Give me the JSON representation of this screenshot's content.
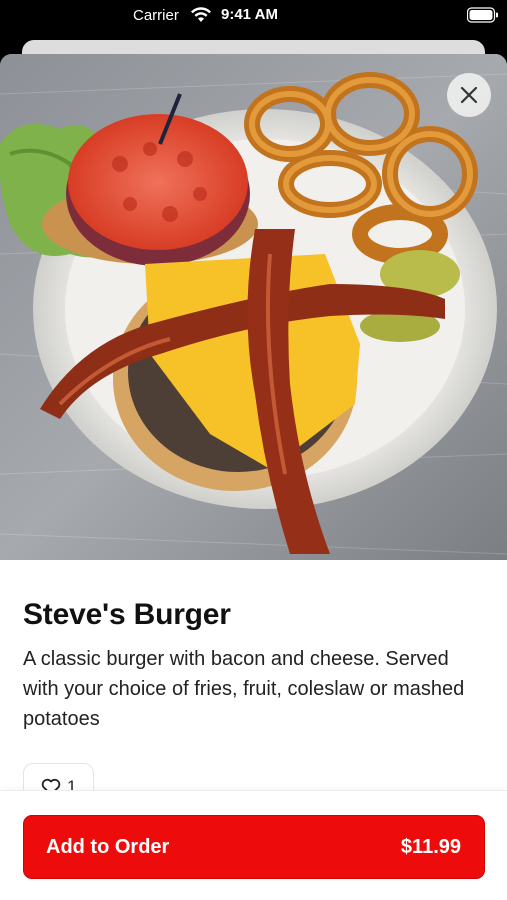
{
  "status_bar": {
    "carrier": "Carrier",
    "time": "9:41 AM",
    "icons": [
      "wifi-icon",
      "battery-icon"
    ]
  },
  "hero": {
    "image": "photo of burger with bacon and cheese, tomato and lettuce, onion rings and pickles on a white plate",
    "close_icon": "close-icon"
  },
  "item": {
    "name": "Steve's Burger",
    "description": "A classic burger with bacon and cheese. Served with your choice of fries, fruit, coleslaw or mashed potatoes"
  },
  "like": {
    "icon": "heart-icon",
    "count": "1"
  },
  "order": {
    "label": "Add to Order",
    "price": "$11.99",
    "accent_color": "#ee0b0b"
  }
}
